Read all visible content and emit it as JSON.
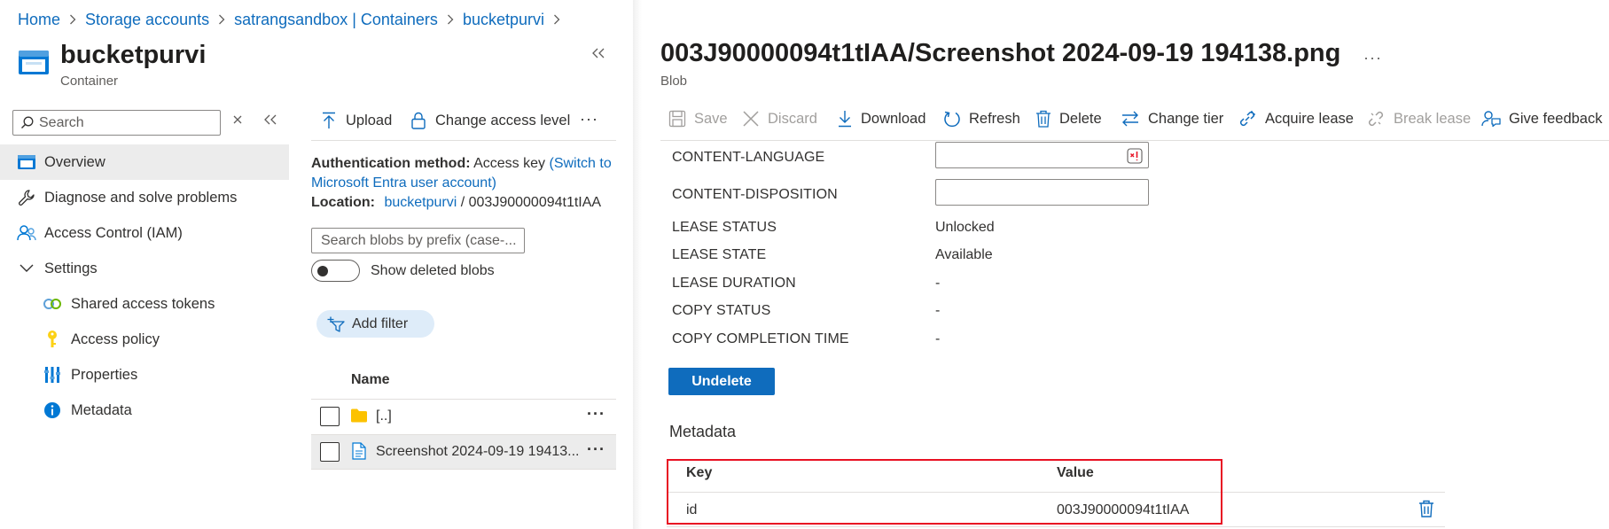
{
  "breadcrumb": {
    "items": [
      "Home",
      "Storage accounts",
      "satrangsandbox | Containers",
      "bucketpurvi"
    ]
  },
  "container": {
    "title": "bucketpurvi",
    "subtitle": "Container"
  },
  "sidebar": {
    "search_placeholder": "Search",
    "items": [
      {
        "label": "Overview",
        "icon": "overview-icon"
      },
      {
        "label": "Diagnose and solve problems",
        "icon": "wrench-icon"
      },
      {
        "label": "Access Control (IAM)",
        "icon": "people-icon"
      },
      {
        "label": "Settings",
        "icon": "chevron-down-icon"
      },
      {
        "label": "Shared access tokens",
        "icon": "link-icon"
      },
      {
        "label": "Access policy",
        "icon": "key-icon"
      },
      {
        "label": "Properties",
        "icon": "properties-icon"
      },
      {
        "label": "Metadata",
        "icon": "info-icon"
      }
    ]
  },
  "container_panel": {
    "toolbar": {
      "upload": "Upload",
      "change_access": "Change access level",
      "more": "···"
    },
    "auth_label": "Authentication method:",
    "auth_value": "Access key",
    "auth_switch_1": "(Switch to",
    "auth_switch_2": "Microsoft Entra user account)",
    "location_label": "Location:",
    "location_link": "bucketpurvi",
    "location_path": "/ 003J90000094t1tIAA",
    "blob_search_placeholder": "Search blobs by prefix (case-...",
    "show_deleted": "Show deleted blobs",
    "add_filter": "Add filter",
    "name_header": "Name",
    "rows": [
      {
        "name": "[..]",
        "type": "folder"
      },
      {
        "name": "Screenshot 2024-09-19 19413...",
        "type": "file"
      }
    ]
  },
  "blob_panel": {
    "title": "003J90000094t1tIAA/Screenshot 2024-09-19 194138.png",
    "subtitle": "Blob",
    "more": "···",
    "toolbar": {
      "save": "Save",
      "discard": "Discard",
      "download": "Download",
      "refresh": "Refresh",
      "delete": "Delete",
      "change_tier": "Change tier",
      "acquire_lease": "Acquire lease",
      "break_lease": "Break lease",
      "give_feedback": "Give feedback"
    },
    "properties": [
      {
        "label": "CONTENT-LANGUAGE",
        "value": ""
      },
      {
        "label": "CONTENT-DISPOSITION",
        "value": ""
      },
      {
        "label": "LEASE STATUS",
        "value": "Unlocked"
      },
      {
        "label": "LEASE STATE",
        "value": "Available"
      },
      {
        "label": "LEASE DURATION",
        "value": "-"
      },
      {
        "label": "COPY STATUS",
        "value": "-"
      },
      {
        "label": "COPY COMPLETION TIME",
        "value": "-"
      }
    ],
    "undelete": "Undelete",
    "metadata_heading": "Metadata",
    "metadata_headers": {
      "key": "Key",
      "value": "Value"
    },
    "metadata_rows": [
      {
        "key": "id",
        "value": "003J90000094t1tIAA"
      }
    ]
  },
  "colors": {
    "accent": "#0f6cbd",
    "highlight_border": "#e81123"
  }
}
